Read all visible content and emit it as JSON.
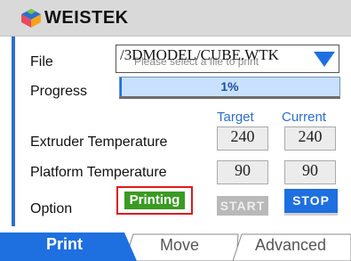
{
  "header": {
    "brand": "WEISTEK"
  },
  "file": {
    "label": "File",
    "value": "/3DMODEL/CUBE.WTK",
    "placeholder": "Please select a file to print"
  },
  "progress": {
    "label": "Progress",
    "value_text": "1%",
    "value": 0.01
  },
  "temperature": {
    "target_header": "Target",
    "current_header": "Current",
    "extruder": {
      "label": "Extruder Temperature",
      "target": "240",
      "current": "240"
    },
    "platform": {
      "label": "Platform Temperature",
      "target": "90",
      "current": "90"
    }
  },
  "option": {
    "label": "Option",
    "status": "Printing",
    "start_label": "START",
    "stop_label": "STOP"
  },
  "tabs": {
    "print": "Print",
    "move": "Move",
    "advanced": "Advanced"
  },
  "colors": {
    "accent": "#1e6fe0",
    "status_green": "#3a9b22",
    "highlight_red": "#e0191f"
  }
}
